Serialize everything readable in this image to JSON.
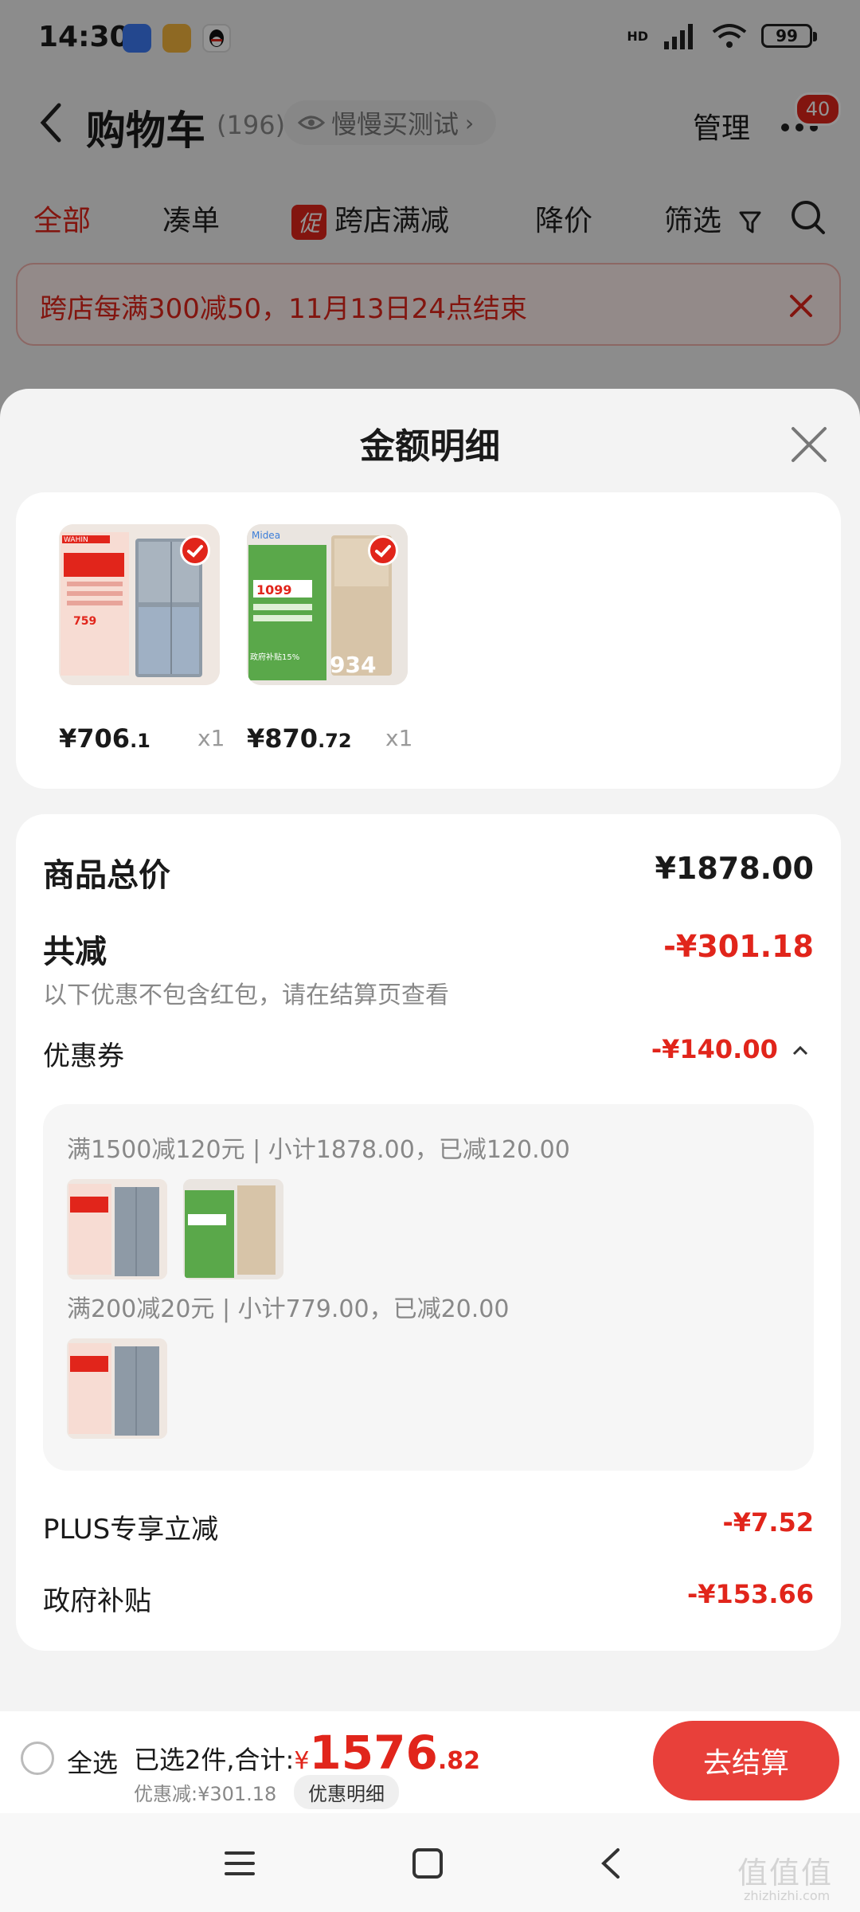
{
  "status_bar": {
    "time": "14:30",
    "network": "HD",
    "battery": "99"
  },
  "nav": {
    "title": "购物车",
    "count": "(196)",
    "slow_buy": "慢慢买测试",
    "manage": "管理",
    "badge": "40"
  },
  "tabs": {
    "all": "全部",
    "combine": "凑单",
    "promo_chip": "促",
    "cross_store": "跨店满减",
    "price_drop": "降价",
    "filter": "筛选"
  },
  "banner": {
    "text": "跨店每满300减50，11月13日24点结束"
  },
  "sheet": {
    "title": "金额明细",
    "products": [
      {
        "brand": "WAHIN",
        "price_main": "¥706",
        "price_dec": ".1",
        "qty": "x1"
      },
      {
        "brand": "Midea",
        "price_main": "¥870",
        "price_dec": ".72",
        "qty": "x1"
      }
    ],
    "summary": {
      "total_label": "商品总价",
      "total_value": "¥1878.00",
      "discount_label": "共减",
      "discount_value": "-¥301.18",
      "discount_note": "以下优惠不包含红包，请在结算页查看",
      "coupon_label": "优惠券",
      "coupon_value": "-¥140.00",
      "coupon_rules": [
        "满1500减120元 | 小计1878.00，已减120.00",
        "满200减20元 | 小计779.00，已减20.00"
      ],
      "plus_label": "PLUS专享立减",
      "plus_value": "-¥7.52",
      "gov_label": "政府补贴",
      "gov_value": "-¥153.66"
    }
  },
  "thumb_text": {
    "wahin_price": "759",
    "midea_promo": "1099",
    "midea_price": "934",
    "midea_subsidy": "政府补贴15%"
  },
  "checkout": {
    "select_all": "全选",
    "selected": "已选2件,合计:",
    "total_symbol": "¥",
    "total_int": "1576",
    "total_dec": ".82",
    "discount_text": "优惠减:¥301.18",
    "detail_button": "优惠明细",
    "checkout_button": "去结算"
  },
  "watermark": {
    "main": "值值值",
    "sub": "zhizhizhi.com"
  },
  "colors": {
    "accent": "#e1251b",
    "checkout_button": "#e8403a"
  }
}
